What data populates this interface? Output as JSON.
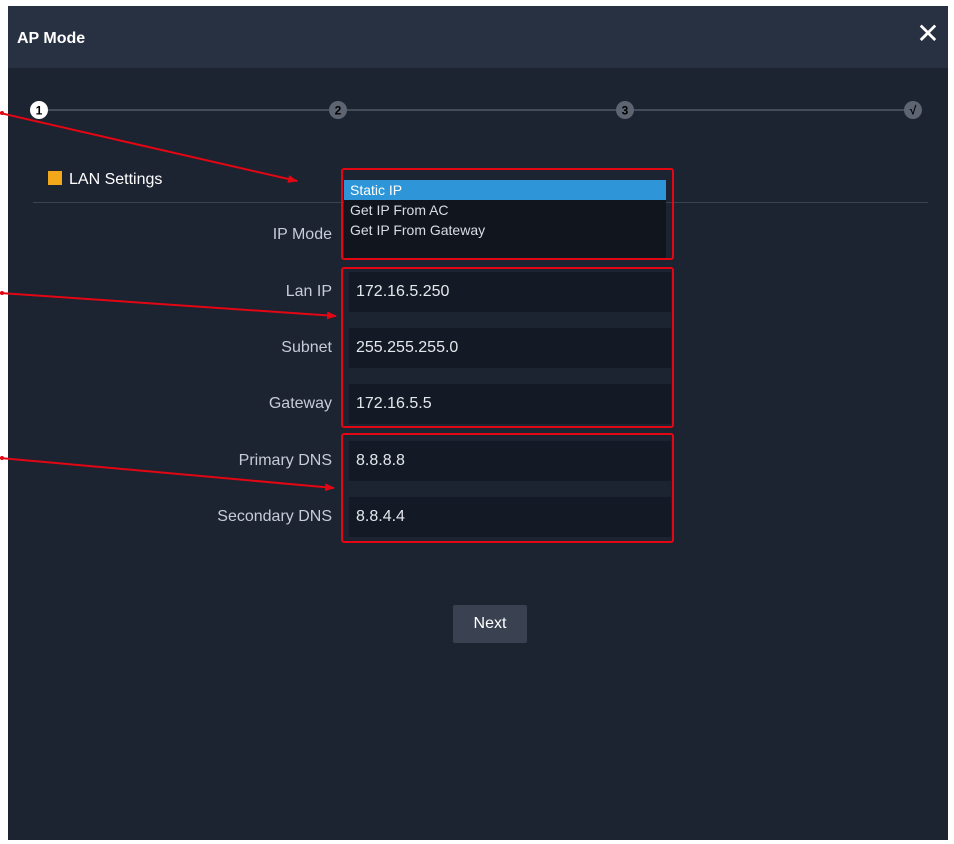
{
  "dialog": {
    "title": "AP Mode",
    "close_glyph": "✕"
  },
  "steps": [
    {
      "label": "1",
      "active": true
    },
    {
      "label": "2",
      "active": false
    },
    {
      "label": "3",
      "active": false
    },
    {
      "label": "√",
      "active": false
    }
  ],
  "section": {
    "title": "LAN Settings"
  },
  "form": {
    "ip_mode": {
      "label": "IP Mode",
      "options": [
        "Static IP",
        "Get IP From AC",
        "Get IP From Gateway"
      ],
      "selected": "Static IP"
    },
    "lan_ip": {
      "label": "Lan IP",
      "value": "172.16.5.250"
    },
    "subnet": {
      "label": "Subnet",
      "value": "255.255.255.0"
    },
    "gateway": {
      "label": "Gateway",
      "value": "172.16.5.5"
    },
    "primary_dns": {
      "label": "Primary DNS",
      "value": "8.8.8.8"
    },
    "secondary_dns": {
      "label": "Secondary DNS",
      "value": "8.8.4.4"
    }
  },
  "buttons": {
    "next": "Next"
  },
  "colors": {
    "background": "#1c2331",
    "titlebar": "#283142",
    "accent_orange": "#f3a71b",
    "selected_blue": "#2e95d8",
    "annotation_red": "#e30613"
  }
}
